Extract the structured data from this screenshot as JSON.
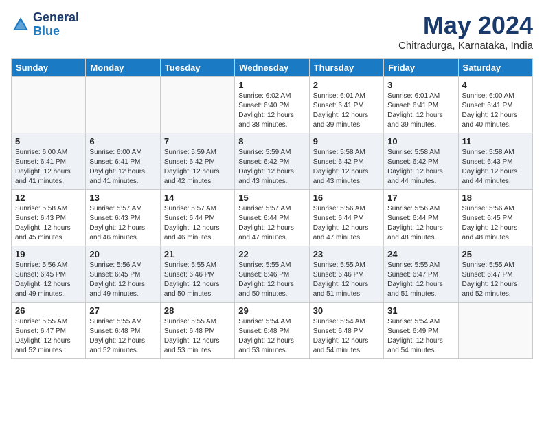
{
  "header": {
    "logo_line1": "General",
    "logo_line2": "Blue",
    "month_year": "May 2024",
    "location": "Chitradurga, Karnataka, India"
  },
  "weekdays": [
    "Sunday",
    "Monday",
    "Tuesday",
    "Wednesday",
    "Thursday",
    "Friday",
    "Saturday"
  ],
  "weeks": [
    [
      {
        "day": "",
        "info": ""
      },
      {
        "day": "",
        "info": ""
      },
      {
        "day": "",
        "info": ""
      },
      {
        "day": "1",
        "info": "Sunrise: 6:02 AM\nSunset: 6:40 PM\nDaylight: 12 hours\nand 38 minutes."
      },
      {
        "day": "2",
        "info": "Sunrise: 6:01 AM\nSunset: 6:41 PM\nDaylight: 12 hours\nand 39 minutes."
      },
      {
        "day": "3",
        "info": "Sunrise: 6:01 AM\nSunset: 6:41 PM\nDaylight: 12 hours\nand 39 minutes."
      },
      {
        "day": "4",
        "info": "Sunrise: 6:00 AM\nSunset: 6:41 PM\nDaylight: 12 hours\nand 40 minutes."
      }
    ],
    [
      {
        "day": "5",
        "info": "Sunrise: 6:00 AM\nSunset: 6:41 PM\nDaylight: 12 hours\nand 41 minutes."
      },
      {
        "day": "6",
        "info": "Sunrise: 6:00 AM\nSunset: 6:41 PM\nDaylight: 12 hours\nand 41 minutes."
      },
      {
        "day": "7",
        "info": "Sunrise: 5:59 AM\nSunset: 6:42 PM\nDaylight: 12 hours\nand 42 minutes."
      },
      {
        "day": "8",
        "info": "Sunrise: 5:59 AM\nSunset: 6:42 PM\nDaylight: 12 hours\nand 43 minutes."
      },
      {
        "day": "9",
        "info": "Sunrise: 5:58 AM\nSunset: 6:42 PM\nDaylight: 12 hours\nand 43 minutes."
      },
      {
        "day": "10",
        "info": "Sunrise: 5:58 AM\nSunset: 6:42 PM\nDaylight: 12 hours\nand 44 minutes."
      },
      {
        "day": "11",
        "info": "Sunrise: 5:58 AM\nSunset: 6:43 PM\nDaylight: 12 hours\nand 44 minutes."
      }
    ],
    [
      {
        "day": "12",
        "info": "Sunrise: 5:58 AM\nSunset: 6:43 PM\nDaylight: 12 hours\nand 45 minutes."
      },
      {
        "day": "13",
        "info": "Sunrise: 5:57 AM\nSunset: 6:43 PM\nDaylight: 12 hours\nand 46 minutes."
      },
      {
        "day": "14",
        "info": "Sunrise: 5:57 AM\nSunset: 6:44 PM\nDaylight: 12 hours\nand 46 minutes."
      },
      {
        "day": "15",
        "info": "Sunrise: 5:57 AM\nSunset: 6:44 PM\nDaylight: 12 hours\nand 47 minutes."
      },
      {
        "day": "16",
        "info": "Sunrise: 5:56 AM\nSunset: 6:44 PM\nDaylight: 12 hours\nand 47 minutes."
      },
      {
        "day": "17",
        "info": "Sunrise: 5:56 AM\nSunset: 6:44 PM\nDaylight: 12 hours\nand 48 minutes."
      },
      {
        "day": "18",
        "info": "Sunrise: 5:56 AM\nSunset: 6:45 PM\nDaylight: 12 hours\nand 48 minutes."
      }
    ],
    [
      {
        "day": "19",
        "info": "Sunrise: 5:56 AM\nSunset: 6:45 PM\nDaylight: 12 hours\nand 49 minutes."
      },
      {
        "day": "20",
        "info": "Sunrise: 5:56 AM\nSunset: 6:45 PM\nDaylight: 12 hours\nand 49 minutes."
      },
      {
        "day": "21",
        "info": "Sunrise: 5:55 AM\nSunset: 6:46 PM\nDaylight: 12 hours\nand 50 minutes."
      },
      {
        "day": "22",
        "info": "Sunrise: 5:55 AM\nSunset: 6:46 PM\nDaylight: 12 hours\nand 50 minutes."
      },
      {
        "day": "23",
        "info": "Sunrise: 5:55 AM\nSunset: 6:46 PM\nDaylight: 12 hours\nand 51 minutes."
      },
      {
        "day": "24",
        "info": "Sunrise: 5:55 AM\nSunset: 6:47 PM\nDaylight: 12 hours\nand 51 minutes."
      },
      {
        "day": "25",
        "info": "Sunrise: 5:55 AM\nSunset: 6:47 PM\nDaylight: 12 hours\nand 52 minutes."
      }
    ],
    [
      {
        "day": "26",
        "info": "Sunrise: 5:55 AM\nSunset: 6:47 PM\nDaylight: 12 hours\nand 52 minutes."
      },
      {
        "day": "27",
        "info": "Sunrise: 5:55 AM\nSunset: 6:48 PM\nDaylight: 12 hours\nand 52 minutes."
      },
      {
        "day": "28",
        "info": "Sunrise: 5:55 AM\nSunset: 6:48 PM\nDaylight: 12 hours\nand 53 minutes."
      },
      {
        "day": "29",
        "info": "Sunrise: 5:54 AM\nSunset: 6:48 PM\nDaylight: 12 hours\nand 53 minutes."
      },
      {
        "day": "30",
        "info": "Sunrise: 5:54 AM\nSunset: 6:48 PM\nDaylight: 12 hours\nand 54 minutes."
      },
      {
        "day": "31",
        "info": "Sunrise: 5:54 AM\nSunset: 6:49 PM\nDaylight: 12 hours\nand 54 minutes."
      },
      {
        "day": "",
        "info": ""
      }
    ]
  ]
}
